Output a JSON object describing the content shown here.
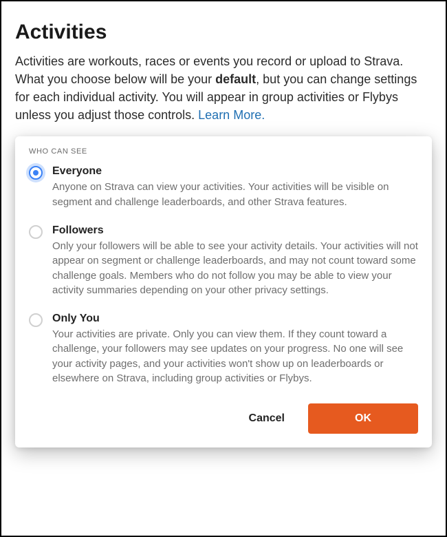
{
  "header": {
    "title": "Activities",
    "description_pre": "Activities are workouts, races or events you record or upload to Strava. What you choose below will be your ",
    "description_bold": "default",
    "description_post": ", but you can change settings for each individual activity. You will appear in group activities or Flybys unless you adjust those controls. ",
    "learn_more": "Learn More."
  },
  "dialog": {
    "label": "WHO CAN SEE",
    "selected_index": 0,
    "options": [
      {
        "title": "Everyone",
        "description": "Anyone on Strava can view your activities. Your activities will be visible on segment and challenge leaderboards, and other Strava features."
      },
      {
        "title": "Followers",
        "description": "Only your followers will be able to see your activity details. Your activities will not appear on segment or challenge leaderboards, and may not count toward some challenge goals. Members who do not follow you may be able to view your activity summaries depending on your other privacy settings."
      },
      {
        "title": "Only You",
        "description": "Your activities are private. Only you can view them. If they count toward a challenge, your followers may see updates on your progress. No one will see your activity pages, and your activities won't show up on leaderboards or elsewhere on Strava, including group activities or Flybys."
      }
    ],
    "actions": {
      "cancel": "Cancel",
      "ok": "OK"
    }
  }
}
